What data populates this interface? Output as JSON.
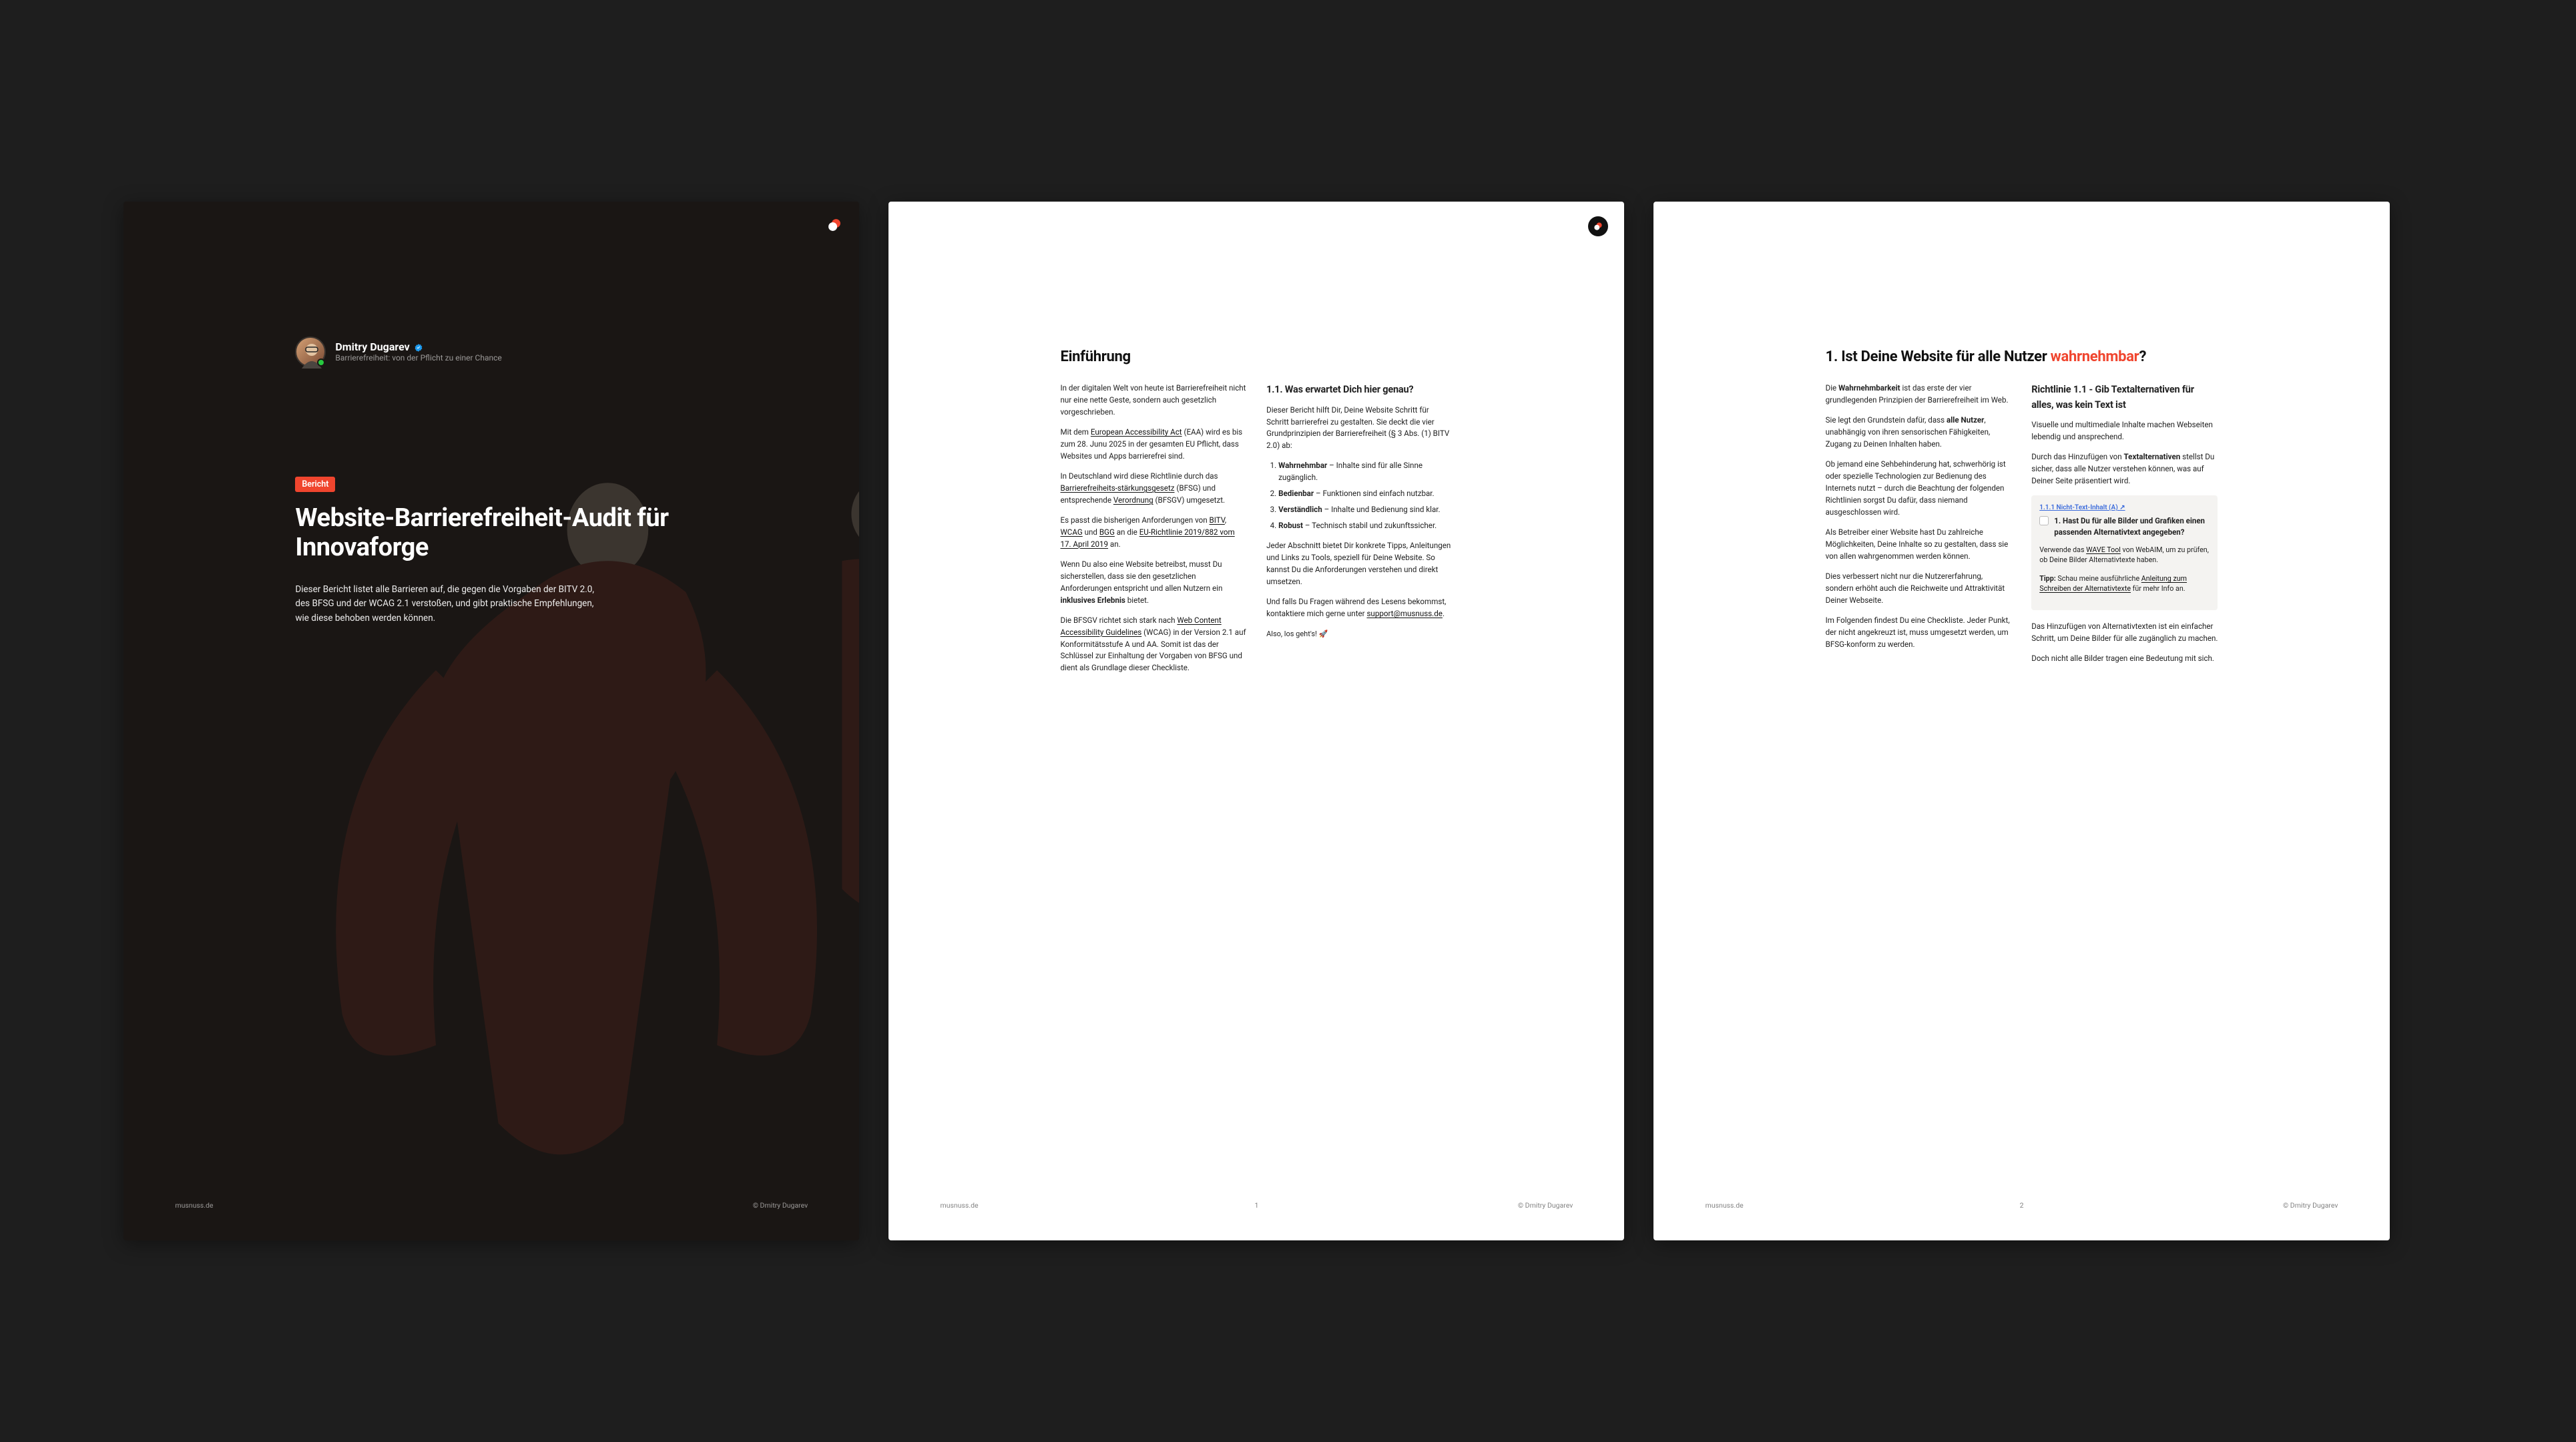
{
  "author": {
    "name": "Dmitry Dugarev",
    "tagline": "Barrierefreiheit: von der Pflicht zu einer Chance"
  },
  "cover": {
    "badge": "Bericht",
    "title": "Website-Barrierefreiheit-Audit für Innovaforge",
    "description": "Dieser Bericht listet alle Barrieren auf, die gegen die Vorgaben der BITV 2.0, des BFSG und der WCAG 2.1 verstoßen, und gibt praktische Empfehlungen, wie diese behoben werden können."
  },
  "footer": {
    "site": "musnuss.de",
    "copyright": "© Dmitry Dugarev"
  },
  "page2": {
    "heading": "Einführung",
    "number": "1",
    "left": {
      "p1": "In der digitalen Welt von heute ist Barrierefreiheit nicht nur eine nette Geste, sondern auch gesetzlich vorgeschrieben.",
      "p2a": "Mit dem ",
      "link_eaa": "European Accessibility Act",
      "p2b": " (EAA) wird es bis zum 28. Junu 2025 in der gesamten EU Pflicht, dass Websites und Apps barrierefrei sind.",
      "p3a": "In Deutschland wird diese Richtlinie durch das ",
      "link_bfsg": "Barrierefreiheits-stärkungsgesetz",
      "p3b": " (BFSG) und entsprechende ",
      "link_verord": "Verordnung",
      "p3c": " (BFSGV) umgesetzt.",
      "p4a": "Es passt die bisherigen Anforderungen von ",
      "link_bitv": "BITV",
      "link_wcag": "WCAG",
      "p4b": " und ",
      "link_bgg": "BGG",
      "p4c": " an die ",
      "link_eurl": "EU-Richtlinie 2019/882 vom 17. April 2019",
      "p4d": " an.",
      "p5a": "Wenn Du also eine Website betreibst, musst Du sicherstellen, dass sie den gesetzlichen Anforderungen entspricht und allen Nutzern ein ",
      "p5strong": "inklusives Erlebnis",
      "p5b": " bietet.",
      "p6a": "Die BFSGV richtet sich stark nach ",
      "link_wcag2": "Web Content Accessibility Guidelines",
      "p6b": " (WCAG) in der Version 2.1 auf Konformitätsstufe A und AA. Somit ist das der Schlüssel zur Einhaltung der Vorgaben von BFSG und dient als Grundlage dieser Checkliste."
    },
    "right": {
      "heading": "1.1. Was erwartet Dich hier genau?",
      "intro": "Dieser Bericht hilft Dir, Deine Website Schritt für Schritt barrierefrei zu gestalten. Sie deckt die vier Grundprinzipien der Barrierefreiheit (§ 3 Abs. (1) BITV 2.0) ab:",
      "principles": [
        {
          "term": "Wahrnehmbar",
          "desc": " – Inhalte sind für alle Sinne zugänglich."
        },
        {
          "term": "Bedienbar",
          "desc": " – Funktionen sind einfach nutzbar."
        },
        {
          "term": "Verständlich",
          "desc": " – Inhalte und Bedienung sind klar."
        },
        {
          "term": "Robust",
          "desc": " – Technisch stabil und zukunftssicher."
        }
      ],
      "p2": "Jeder Abschnitt bietet Dir konkrete Tipps, Anleitungen und Links zu Tools, speziell für Deine Website. So kannst Du die Anforderungen verstehen und direkt umsetzen.",
      "p3a": "Und falls Du Fragen während des Lesens bekommst, kontaktiere mich gerne unter ",
      "email": "support@musnuss.de",
      "p3b": ".",
      "p4": "Also, los geht's! 🚀"
    }
  },
  "page3": {
    "heading_pre": "1. Ist Deine Website für alle Nutzer ",
    "heading_accent": "wahrnehmbar",
    "heading_post": "?",
    "number": "2",
    "left": {
      "p1a": "Die ",
      "p1strong": "Wahrnehmbarkeit",
      "p1b": " ist das erste der vier grundlegenden Prinzipien der Barrierefreiheit im Web.",
      "p2a": "Sie legt den Grundstein dafür, dass ",
      "p2strong": "alle Nutzer",
      "p2b": ", unabhängig von ihren sensorischen Fähigkeiten, Zugang zu Deinen Inhalten haben.",
      "p3": "Ob jemand eine Sehbehinderung hat, schwerhörig ist oder spezielle Technologien zur Bedienung des Internets nutzt – durch die Beachtung der folgenden Richtlinien sorgst Du dafür, dass niemand ausgeschlossen wird.",
      "p4": "Als Betreiber einer  Website hast Du zahlreiche Möglichkeiten, Deine Inhalte so zu gestalten, dass sie von allen wahrgenommen werden können.",
      "p5": "Dies verbessert nicht nur die Nutzererfahrung, sondern erhöht auch die Reichweite und Attraktivität Deiner Webseite.",
      "p6": "Im Folgenden findest Du eine Checkliste. Jeder Punkt, der nicht angekreuzt ist, muss umgesetzt werden, um BFSG-konform zu werden."
    },
    "right": {
      "heading": "Richtlinie 1.1 - Gib Textalternativen für alles, was kein Text ist",
      "p1": "Visuelle und multimediale Inhalte machen Webseiten lebendig und ansprechend.",
      "p2a": "Durch das Hinzufügen von ",
      "p2strong": "Textalternativen",
      "p2b": " stellst Du sicher, dass alle Nutzer verstehen können, was auf Deiner Seite präsentiert wird.",
      "card": {
        "tag": "1.1.1 Nicht-Text-Inhalt (A) ↗",
        "question": "1. Hast Du für alle Bilder und Grafiken einen passenden Alternativtext angegeben?",
        "body1a": "Verwende das ",
        "body1link": "WAVE Tool",
        "body1b": " von WebAIM, um zu prüfen, ob Deine Bilder Alternativtexte haben.",
        "tip_label": "Tipp:",
        "tip_body_a": " Schau meine ausführliche ",
        "tip_link": "Anleitung zum Schreiben der Alternativtexte",
        "tip_body_b": " für mehr Info an."
      },
      "p3": "Das Hinzufügen von Alternativtexten ist ein einfacher Schritt, um Deine Bilder für alle zugänglich zu machen.",
      "p4": "Doch nicht alle Bilder tragen eine Bedeutung mit sich."
    }
  }
}
